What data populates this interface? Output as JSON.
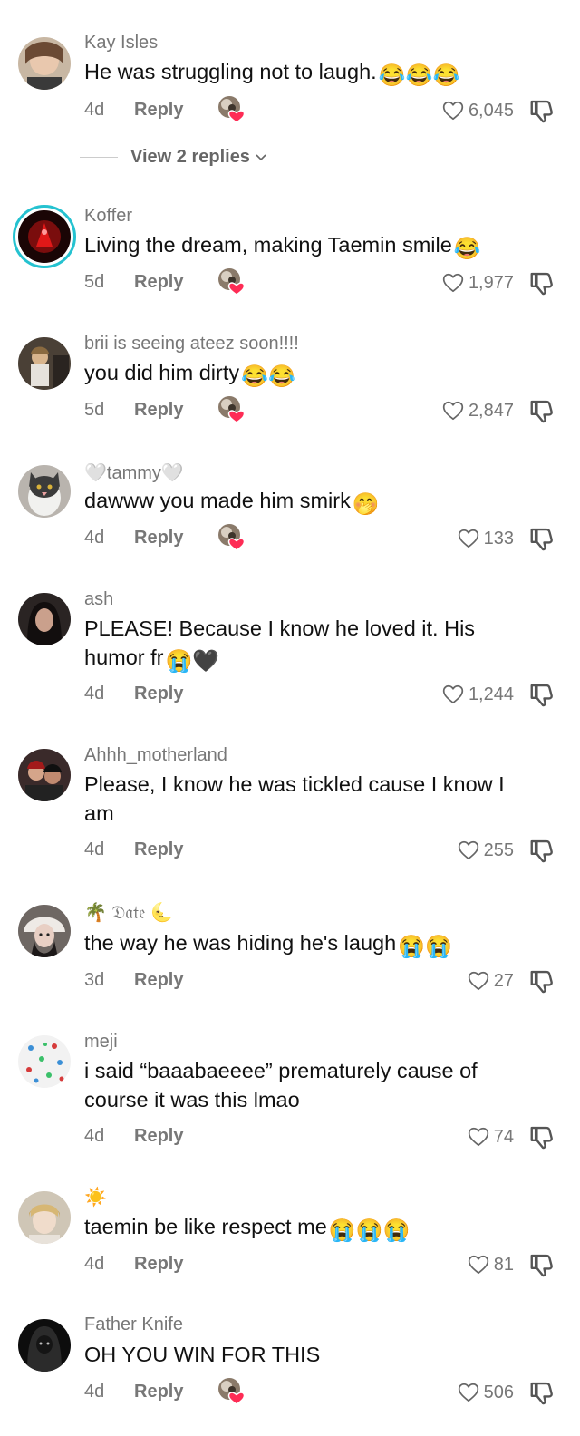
{
  "reply_label": "Reply",
  "view_replies": "View 2 replies",
  "comments": [
    {
      "username": "Kay Isles",
      "text": "He was struggling not to laugh.",
      "emoji": "😂😂😂",
      "time": "4d",
      "likes": "6,045",
      "creator_liked": true
    },
    {
      "username": "Koffer",
      "text": "Living the dream, making Taemin smile",
      "emoji": "😂",
      "time": "5d",
      "likes": "1,977",
      "creator_liked": true
    },
    {
      "username": "brii is seeing ateez soon!!!!",
      "text": "you did him dirty",
      "emoji": "😂😂",
      "time": "5d",
      "likes": "2,847",
      "creator_liked": true
    },
    {
      "username": "🤍tammy🤍",
      "text": "dawww you made him smirk",
      "emoji": "🤭",
      "time": "4d",
      "likes": "133",
      "creator_liked": true
    },
    {
      "username": "ash",
      "text": "PLEASE! Because I know he loved it. His humor fr",
      "emoji": "😭🖤",
      "time": "4d",
      "likes": "1,244",
      "creator_liked": false
    },
    {
      "username": "Ahhh_motherland",
      "text": "Please, I know he was tickled cause I know I am",
      "emoji": "",
      "time": "4d",
      "likes": "255",
      "creator_liked": false
    },
    {
      "username": "🌴 𝔇𝔞𝔱𝔢 🌜",
      "text": "the way he was hiding he's laugh",
      "emoji": "😭😭",
      "time": "3d",
      "likes": "27",
      "creator_liked": false
    },
    {
      "username": "meji",
      "text": "i said “baaabaeeee” prematurely cause of course it was this lmao",
      "emoji": "",
      "time": "4d",
      "likes": "74",
      "creator_liked": false
    },
    {
      "username": "☀️",
      "text": "taemin be like respect me",
      "emoji": "😭😭😭",
      "time": "4d",
      "likes": "81",
      "creator_liked": false
    },
    {
      "username": "Father Knife",
      "text": "OH YOU WIN FOR THIS",
      "emoji": "",
      "time": "4d",
      "likes": "506",
      "creator_liked": true
    }
  ],
  "icons": {
    "like": "heart-outline-icon",
    "dislike": "thumbs-down-icon",
    "creator_like": "creator-liked-heart-icon",
    "expand": "chevron-down-icon"
  },
  "colors": {
    "username": "#777777",
    "text": "#111111",
    "ring": "#25c2d0",
    "heart_badge": "#fe2c55"
  }
}
